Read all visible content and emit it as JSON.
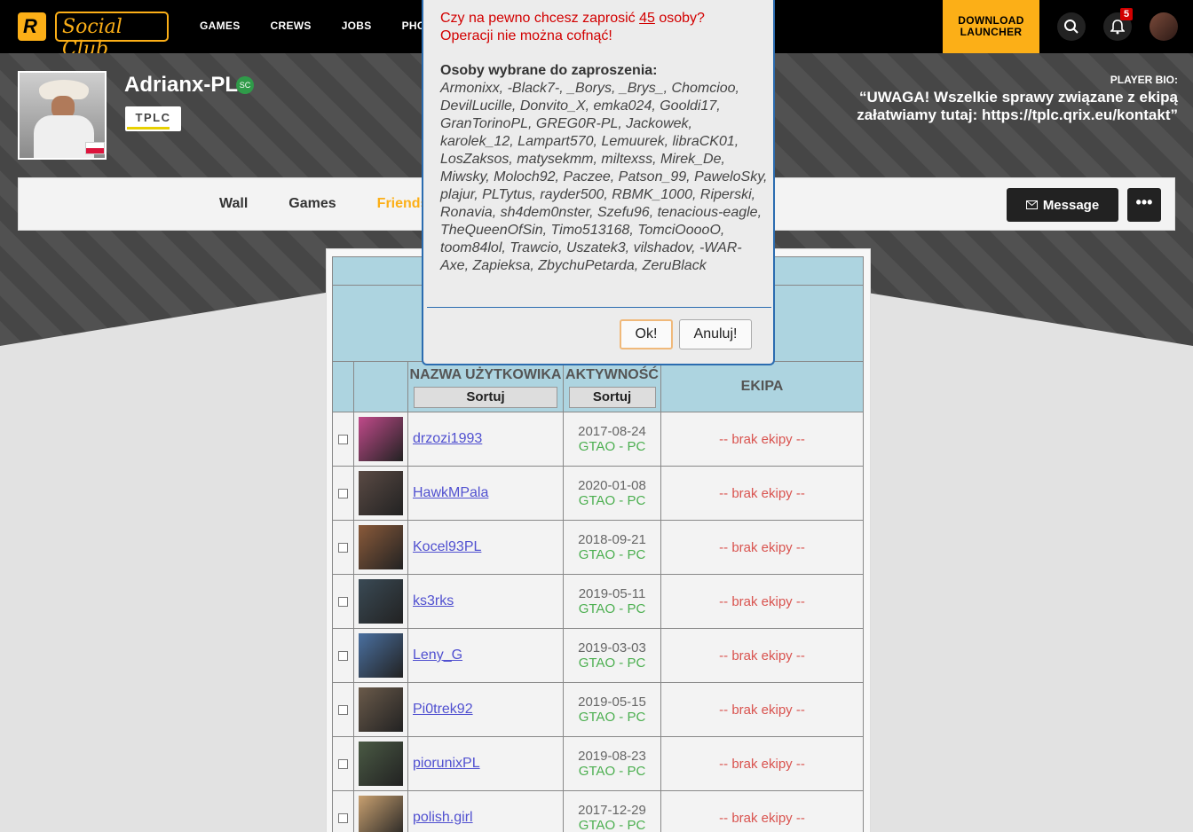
{
  "topnav": {
    "logo_letter": "R",
    "logo_text": "Social Club",
    "links": [
      "GAMES",
      "CREWS",
      "JOBS",
      "PHOTO"
    ],
    "download_line1": "DOWNLOAD",
    "download_line2": "LAUNCHER",
    "notification_count": "5"
  },
  "profile": {
    "username": "Adrianx-PL",
    "crew_tag": "TPLC",
    "bio_label": "PLAYER BIO:",
    "bio_text": "“UWAGA! Wszelkie sprawy związane z ekipą załatwiamy tutaj: https://tplc.qrix.eu/kontakt”"
  },
  "tabs": [
    "Wall",
    "Games",
    "Friends"
  ],
  "message_button": "Message",
  "more_button": "•••",
  "table": {
    "headers": {
      "username": "NAZWA UŻYTKOWIKA",
      "activity": "AKTYWNOŚĆ",
      "crew": "EKIPA",
      "sort": "Sortuj"
    },
    "rows": [
      {
        "name": "drzozi1993",
        "date": "2017-08-24",
        "platform": "GTAO - PC",
        "crew": "-- brak ekipy --",
        "avatar_color": "#c04a8a"
      },
      {
        "name": "HawkMPala",
        "date": "2020-01-08",
        "platform": "GTAO - PC",
        "crew": "-- brak ekipy --",
        "avatar_color": "#5a4a44"
      },
      {
        "name": "Kocel93PL",
        "date": "2018-09-21",
        "platform": "GTAO - PC",
        "crew": "-- brak ekipy --",
        "avatar_color": "#8a5a3a"
      },
      {
        "name": "ks3rks",
        "date": "2019-05-11",
        "platform": "GTAO - PC",
        "crew": "-- brak ekipy --",
        "avatar_color": "#3a4a55"
      },
      {
        "name": "Leny_G",
        "date": "2019-03-03",
        "platform": "GTAO - PC",
        "crew": "-- brak ekipy --",
        "avatar_color": "#4a70a0"
      },
      {
        "name": "Pi0trek92",
        "date": "2019-05-15",
        "platform": "GTAO - PC",
        "crew": "-- brak ekipy --",
        "avatar_color": "#6a5a4a"
      },
      {
        "name": "piorunixPL",
        "date": "2019-08-23",
        "platform": "GTAO - PC",
        "crew": "-- brak ekipy --",
        "avatar_color": "#4a5a44"
      },
      {
        "name": "polish.girl",
        "date": "2017-12-29",
        "platform": "GTAO - PC",
        "crew": "-- brak ekipy --",
        "avatar_color": "#c8a070"
      }
    ]
  },
  "dialog": {
    "question_pre": "Czy na pewno chcesz zaprosić ",
    "question_count": "45",
    "question_post": " osoby?",
    "warning": "Operacji nie można cofnąć!",
    "selected_label": "Osoby wybrane do zaproszenia:",
    "selected_list": "Armonixx, -Black7-, _Borys, _Brys_, Chomcioo, DevilLucille, Donvito_X, emka024, Gooldi17, GranTorinoPL, GREG0R-PL, Jackowek, karolek_12, Lampart570, Lemuurek, libraCK01, LosZaksos, matysekmm, miltexss, Mirek_De, Miwsky, Moloch92, Paczee, Patson_99, PaweloSky, plajur, PLTytus, rayder500, RBMK_1000, Riperski, Ronavia, sh4dem0nster, Szefu96, tenacious-eagle, TheQueenOfSin, Timo513168, TomciOoooO, toom84lol, Trawcio, Uszatek3, vilshadov, -WAR-Axe, Zapieksa, ZbychuPetarda, ZeruBlack",
    "ok_label": "Ok!",
    "cancel_label": "Anuluj!"
  }
}
